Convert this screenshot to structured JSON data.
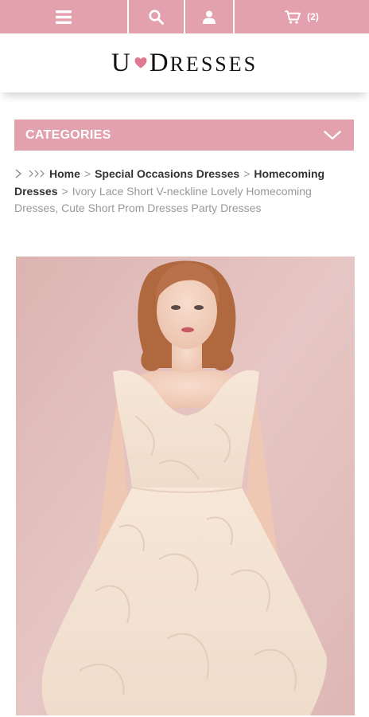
{
  "nav": {
    "cart_count": "(2)"
  },
  "logo": {
    "letter_u": "U",
    "letter_d": "D",
    "rest": "RESSES"
  },
  "categories": {
    "label": "CATEGORIES"
  },
  "breadcrumb": {
    "home": "Home",
    "special": "Special Occasions Dresses",
    "homecoming": "Homecoming Dresses",
    "current": "Ivory Lace Short V-neckline Lovely Homecoming Dresses, Cute Short Prom Dresses Party Dresses",
    "separator": ">"
  },
  "icons": {
    "menu": "menu-icon",
    "search": "search-icon",
    "account": "user-icon",
    "cart": "cart-icon",
    "categories_toggle": "chevron-down-icon",
    "logo_heart": "heart-icon"
  },
  "colors": {
    "brand_pink": "#e3a1ad",
    "heart": "#e07a90"
  }
}
